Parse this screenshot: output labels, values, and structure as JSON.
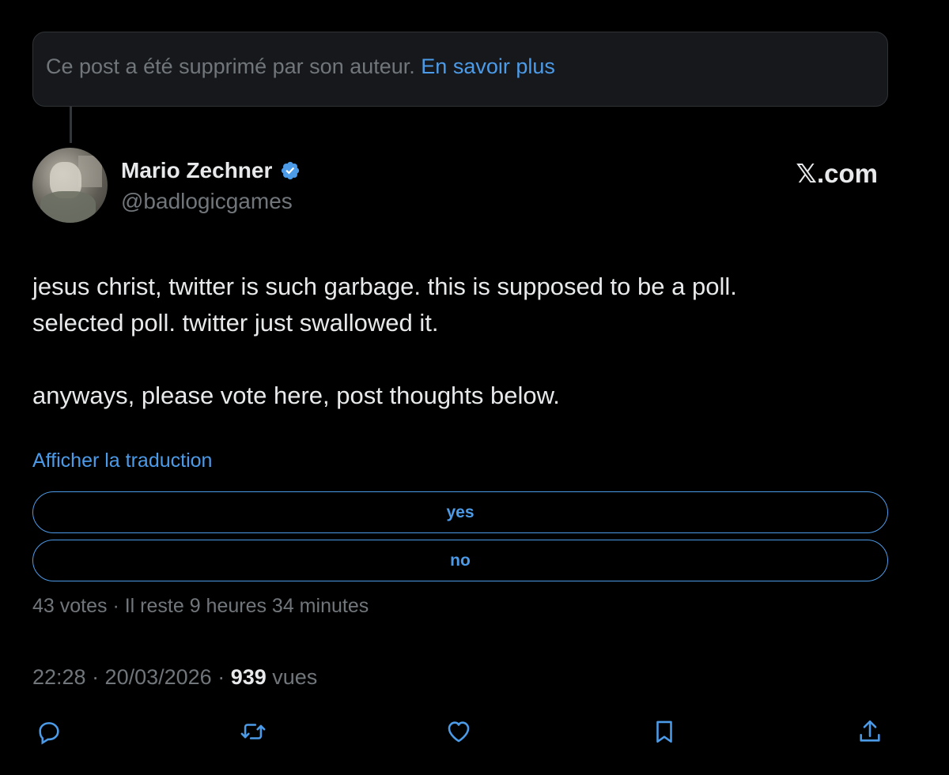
{
  "deleted_notice": {
    "text": "Ce post a été supprimé par son auteur.",
    "link": "En savoir plus"
  },
  "author": {
    "name": "Mario Zechner",
    "handle": "@badlogicgames",
    "verified": true
  },
  "site": "𝕏.com",
  "post": {
    "line1": "jesus christ, twitter is such garbage. this is supposed to be a poll.",
    "line2": "selected poll. twitter just swallowed it.",
    "line3": "anyways, please vote here, post thoughts below."
  },
  "translate_label": "Afficher la traduction",
  "poll": {
    "options": [
      {
        "label": "yes"
      },
      {
        "label": "no"
      }
    ],
    "meta": "43 votes · Il reste 9 heures 34 minutes"
  },
  "timestamp": {
    "time_date": "22:28 · 20/03/2026 · ",
    "views": "939",
    "views_label": " vues"
  },
  "actions": {
    "reply": "reply-icon",
    "repost": "repost-icon",
    "like": "heart-icon",
    "bookmark": "bookmark-icon",
    "share": "share-icon"
  },
  "colors": {
    "background": "#000000",
    "accent": "#4c9be8",
    "muted": "#71767b",
    "text": "#e7e9ea"
  }
}
